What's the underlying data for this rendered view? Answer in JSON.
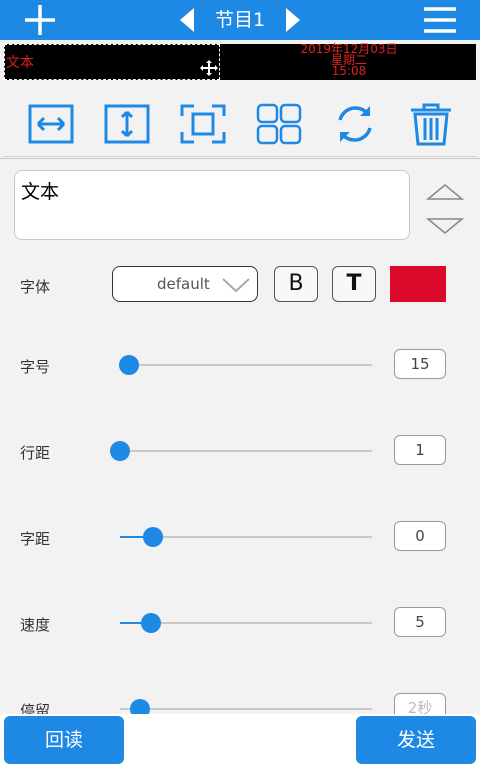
{
  "header": {
    "title": "节目1"
  },
  "preview": {
    "text": "文本",
    "clock_line1": "2019年12月03日",
    "clock_line2": "星期二",
    "clock_line3": "15:08"
  },
  "editor": {
    "text": "文本"
  },
  "font": {
    "label": "字体",
    "value": "default",
    "bold_label": "B",
    "style_label": "T",
    "color": "#dc0a2a"
  },
  "sliders": [
    {
      "label": "字号",
      "value": "15"
    },
    {
      "label": "行距",
      "value": "1"
    },
    {
      "label": "字距",
      "value": "0"
    },
    {
      "label": "速度",
      "value": "5"
    },
    {
      "label": "停留",
      "value": "2秒"
    }
  ],
  "footer": {
    "readback_label": "回读",
    "send_label": "发送"
  },
  "colors": {
    "accent": "#1e88e5",
    "preview_text": "#e0201a"
  }
}
